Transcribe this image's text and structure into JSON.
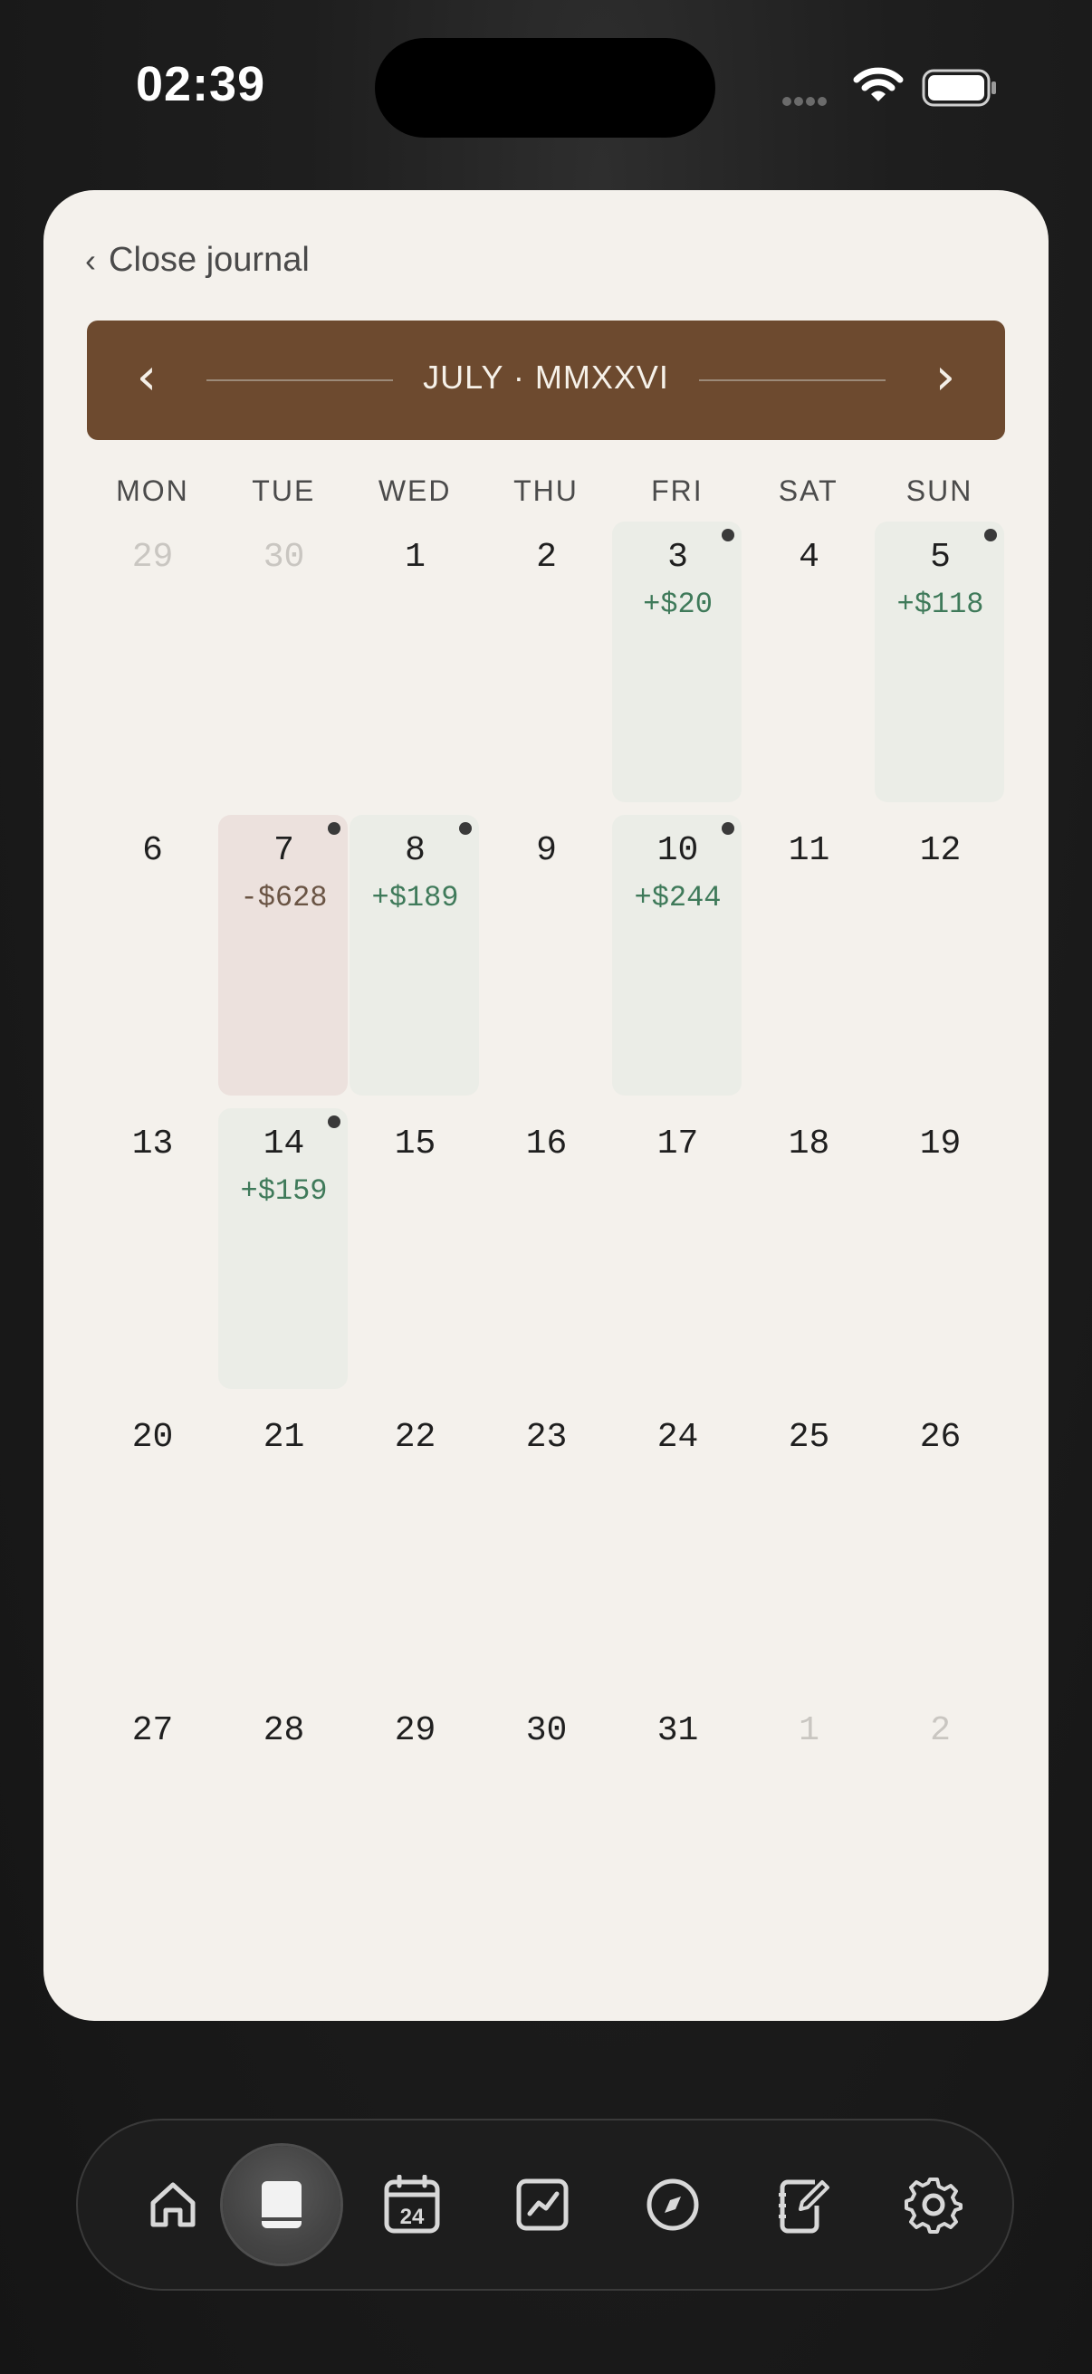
{
  "status_bar": {
    "time": "02:39"
  },
  "journal": {
    "close_label": "Close journal",
    "close_chevron": "‹",
    "month_title": "JULY · MMXXVI",
    "prev_glyph": "‹",
    "next_glyph": "›",
    "weekdays": [
      "MON",
      "TUE",
      "WED",
      "THU",
      "FRI",
      "SAT",
      "SUN"
    ]
  },
  "calendar": {
    "weeks": [
      [
        {
          "day": "29",
          "muted": true
        },
        {
          "day": "30",
          "muted": true
        },
        {
          "day": "1"
        },
        {
          "day": "2"
        },
        {
          "day": "3",
          "amount": "+$20",
          "kind": "gain",
          "entry": true
        },
        {
          "day": "4"
        },
        {
          "day": "5",
          "amount": "+$118",
          "kind": "gain",
          "entry": true
        }
      ],
      [
        {
          "day": "6"
        },
        {
          "day": "7",
          "amount": "-$628",
          "kind": "loss",
          "entry": true
        },
        {
          "day": "8",
          "amount": "+$189",
          "kind": "gain",
          "entry": true
        },
        {
          "day": "9"
        },
        {
          "day": "10",
          "amount": "+$244",
          "kind": "gain",
          "entry": true
        },
        {
          "day": "11"
        },
        {
          "day": "12"
        }
      ],
      [
        {
          "day": "13"
        },
        {
          "day": "14",
          "amount": "+$159",
          "kind": "gain",
          "entry": true
        },
        {
          "day": "15"
        },
        {
          "day": "16"
        },
        {
          "day": "17"
        },
        {
          "day": "18"
        },
        {
          "day": "19"
        }
      ],
      [
        {
          "day": "20"
        },
        {
          "day": "21"
        },
        {
          "day": "22"
        },
        {
          "day": "23"
        },
        {
          "day": "24"
        },
        {
          "day": "25"
        },
        {
          "day": "26"
        }
      ],
      [
        {
          "day": "27"
        },
        {
          "day": "28"
        },
        {
          "day": "29"
        },
        {
          "day": "30"
        },
        {
          "day": "31"
        },
        {
          "day": "1",
          "muted": true
        },
        {
          "day": "2",
          "muted": true
        }
      ]
    ]
  },
  "colors": {
    "gain_text": "#3f7a5a",
    "gain_bg": "#ebede7",
    "loss_text": "#6a5444",
    "loss_bg": "#ece1dd",
    "month_bar": "#6d4a2f"
  },
  "dock": {
    "items": [
      {
        "name": "home-icon",
        "active": false
      },
      {
        "name": "journal-icon",
        "active": true
      },
      {
        "name": "calendar-icon",
        "active": false,
        "label": "24"
      },
      {
        "name": "chart-icon",
        "active": false
      },
      {
        "name": "compass-icon",
        "active": false
      },
      {
        "name": "notebook-edit-icon",
        "active": false
      },
      {
        "name": "settings-gear-icon",
        "active": false
      }
    ]
  }
}
